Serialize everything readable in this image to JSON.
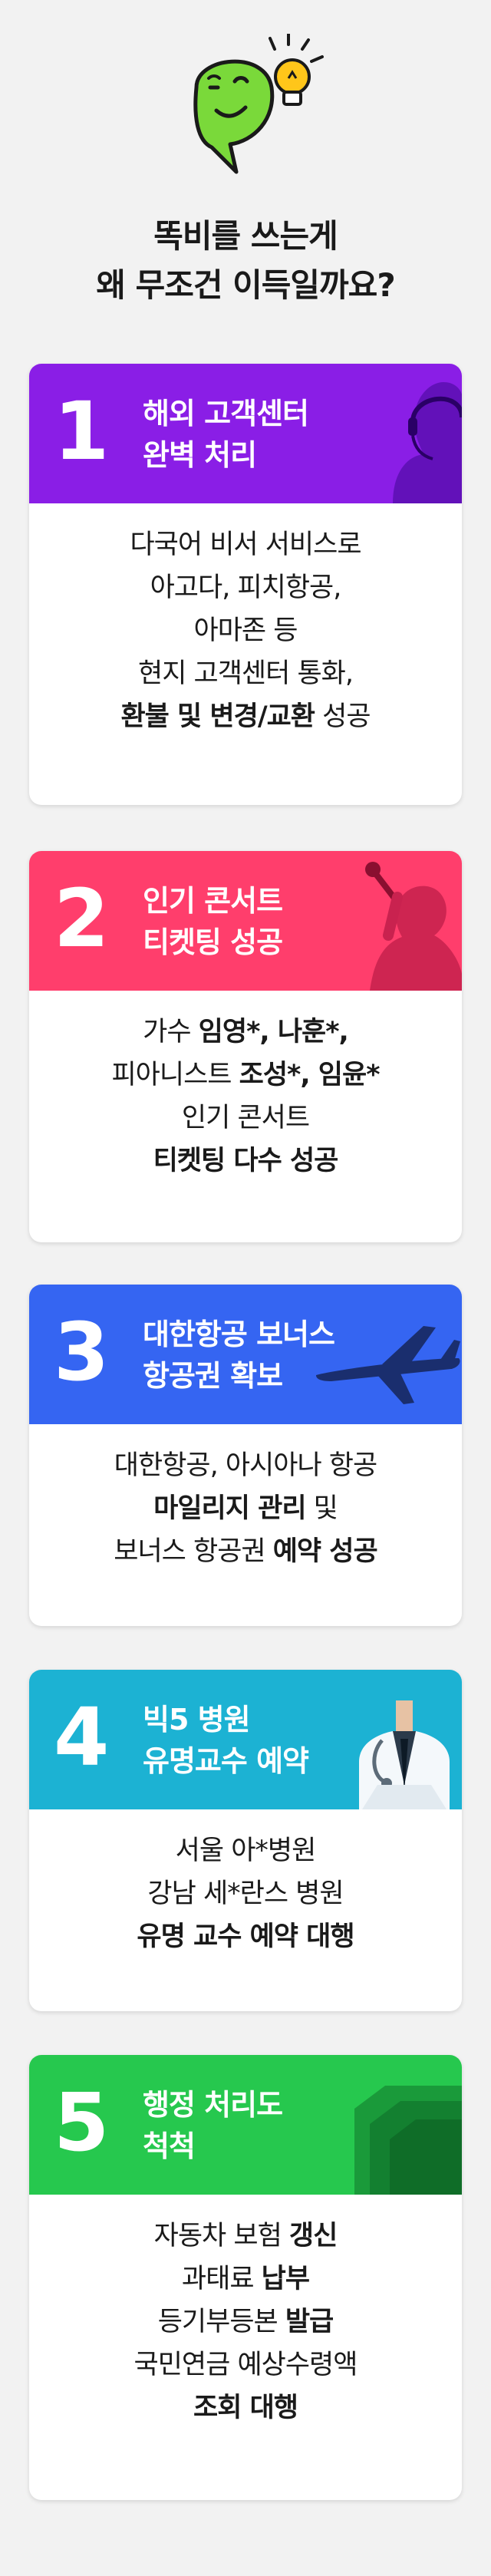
{
  "headline": {
    "line1": "똑비를 쓰는게",
    "line2": "왜 무조건 이득일까요?"
  },
  "colors": {
    "card1": "#8a1ee6",
    "card2": "#ff3e6c",
    "card3": "#3565f2",
    "card4": "#1cb2d3",
    "card5": "#26c84e",
    "mascot": "#7ad93a",
    "bulb": "#ffc61a"
  },
  "cards": [
    {
      "num": "1",
      "title1": "해외 고객센터",
      "title2": "완벽 처리",
      "icon": "headset-agent-icon",
      "lines": [
        [
          {
            "t": "다국어 비서 서비스로",
            "b": false
          }
        ],
        [
          {
            "t": "아고다, 피치항공,",
            "b": false
          }
        ],
        [
          {
            "t": "아마존 등",
            "b": false
          }
        ],
        [
          {
            "t": "현지 고객센터 통화,",
            "b": false
          }
        ],
        [
          {
            "t": "환불 및 변경/교환",
            "b": true
          },
          {
            "t": " 성공",
            "b": false
          }
        ]
      ]
    },
    {
      "num": "2",
      "title1": "인기 콘서트",
      "title2": "티켓팅 성공",
      "icon": "singer-silhouette-icon",
      "lines": [
        [
          {
            "t": "가수 ",
            "b": false
          },
          {
            "t": "임영*, 나훈*,",
            "b": true
          }
        ],
        [
          {
            "t": "피아니스트 ",
            "b": false
          },
          {
            "t": "조성*, 임윤*",
            "b": true
          }
        ],
        [
          {
            "t": "인기 콘서트",
            "b": false
          }
        ],
        [
          {
            "t": "티켓팅 다수 성공",
            "b": true
          }
        ]
      ]
    },
    {
      "num": "3",
      "title1": "대한항공 보너스",
      "title2": "항공권 확보",
      "icon": "airplane-icon",
      "lines": [
        [
          {
            "t": "대한항공, 아시아나 항공",
            "b": false
          }
        ],
        [
          {
            "t": "마일리지 관리",
            "b": true
          },
          {
            "t": " 및",
            "b": false
          }
        ],
        [
          {
            "t": "보너스 항공권 ",
            "b": false
          },
          {
            "t": "예약 성공",
            "b": true
          }
        ]
      ]
    },
    {
      "num": "4",
      "title1": "빅5 병원",
      "title2": "유명교수 예약",
      "icon": "doctor-icon",
      "lines": [
        [
          {
            "t": "서울 아*병원",
            "b": false
          }
        ],
        [
          {
            "t": "강남 세*란스 병원",
            "b": false
          }
        ],
        [
          {
            "t": "유명 교수 예약 대행",
            "b": true
          }
        ]
      ]
    },
    {
      "num": "5",
      "title1": "행정 처리도",
      "title2": "척척",
      "icon": "folder-icon",
      "lines": [
        [
          {
            "t": "자동차 보험 ",
            "b": false
          },
          {
            "t": "갱신",
            "b": true
          }
        ],
        [
          {
            "t": "과태료 ",
            "b": false
          },
          {
            "t": "납부",
            "b": true
          }
        ],
        [
          {
            "t": "등기부등본 ",
            "b": false
          },
          {
            "t": "발급",
            "b": true
          }
        ],
        [
          {
            "t": "국민연금 예상수령액",
            "b": false
          }
        ],
        [
          {
            "t": "조회 대행",
            "b": true
          }
        ]
      ]
    }
  ]
}
